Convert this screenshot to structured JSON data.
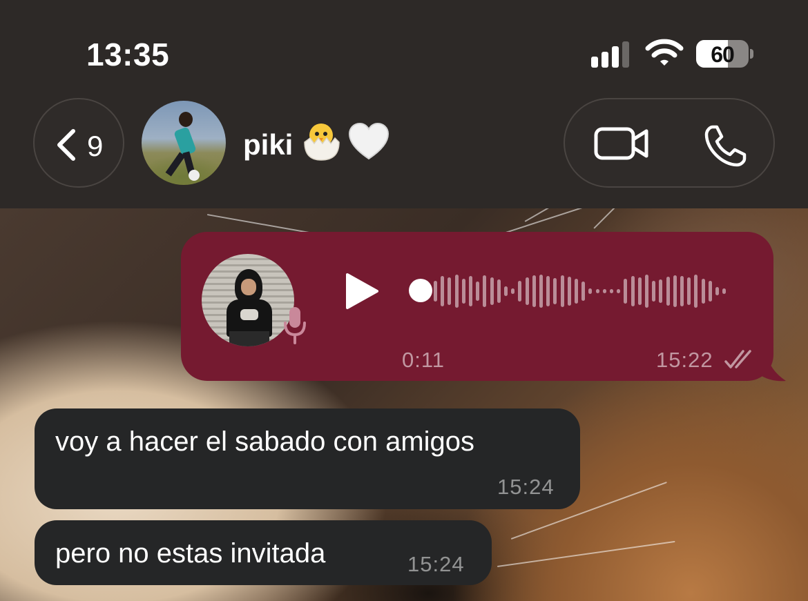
{
  "status_bar": {
    "time": "13:35",
    "battery_percent": "60",
    "battery_level": 0.6,
    "signal_bars": 3,
    "icons": [
      "cellular-signal-icon",
      "wifi-icon",
      "battery-icon"
    ]
  },
  "header": {
    "back_count": "9",
    "contact_name": "piki",
    "name_emojis": [
      "hatching-chick-emoji",
      "white-heart-emoji"
    ],
    "actions": [
      "video-call-icon",
      "voice-call-icon"
    ]
  },
  "messages": [
    {
      "type": "voice",
      "direction": "outgoing",
      "duration": "0:11",
      "time": "15:22",
      "status": "read-ticks",
      "bubble_color": "#751a30",
      "progress": 0
    },
    {
      "type": "text",
      "direction": "incoming",
      "text": "voy a hacer el sabado con amigos",
      "time": "15:24"
    },
    {
      "type": "text",
      "direction": "incoming",
      "text": "pero no estas invitada",
      "time": "15:24"
    }
  ],
  "colors": {
    "header_bg": "#2d2927",
    "incoming_bubble": "#252627",
    "outgoing_bubble": "#751a30"
  }
}
